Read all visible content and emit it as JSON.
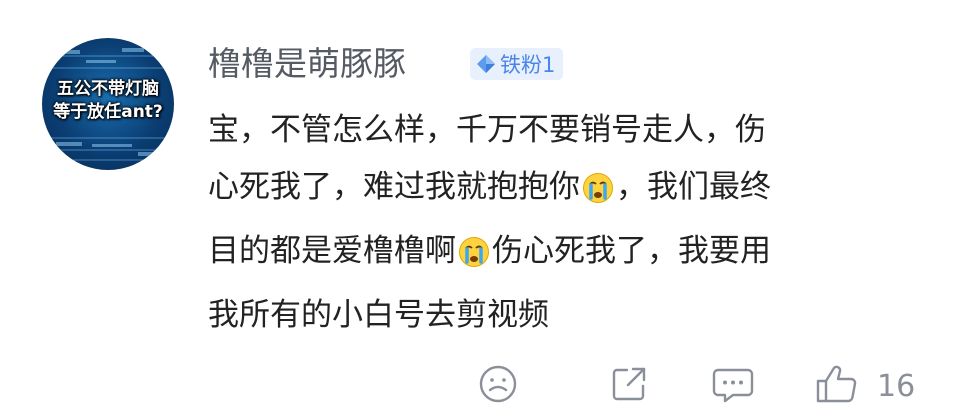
{
  "user": {
    "avatar_text_line1": "五公不带灯脑",
    "avatar_text_line2": "等于放任ant?",
    "name": "橹橹是萌豚豚",
    "badge_label": "铁粉1",
    "badge_icon": "diamond-icon"
  },
  "comment": {
    "line1": "宝，不管怎么样，千万不要销号走人，伤",
    "line2_part1": "心死我了，难过我就抱抱你",
    "line2_emoji": "crying-face-emoji",
    "line2_part2": "，我们最终",
    "line3_part1": "目的都是爱橹橹啊",
    "line3_emoji": "crying-face-emoji",
    "line3_part2": "伤心死我了，我要用",
    "line4": "我所有的小白号去剪视频"
  },
  "actions": {
    "icons": [
      "sad-face-icon",
      "share-icon",
      "comment-icon",
      "thumbs-up-icon"
    ],
    "like_count": "16"
  },
  "colors": {
    "username": "#555a63",
    "badge_bg": "#e8f0fd",
    "badge_text": "#4a86e8",
    "text": "#222222",
    "icon": "#8a8f99"
  }
}
